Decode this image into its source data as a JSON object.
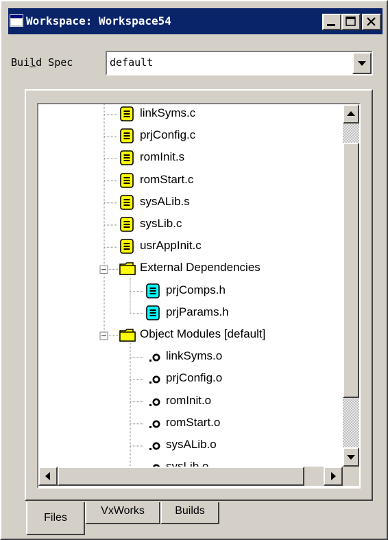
{
  "window": {
    "title": "Workspace: Workspace54",
    "buttons": {
      "minimize": "minimize",
      "maximize": "maximize",
      "close": "close"
    }
  },
  "build_spec": {
    "label_before": "Bui",
    "label_underlined": "l",
    "label_after": "d Spec",
    "value": "default"
  },
  "tree": {
    "items": [
      {
        "label": "linkSyms.c",
        "icon": "source-file-icon"
      },
      {
        "label": "prjConfig.c",
        "icon": "source-file-icon"
      },
      {
        "label": "romInit.s",
        "icon": "source-file-icon"
      },
      {
        "label": "romStart.c",
        "icon": "source-file-icon"
      },
      {
        "label": "sysALib.s",
        "icon": "source-file-icon"
      },
      {
        "label": "sysLib.c",
        "icon": "source-file-icon"
      },
      {
        "label": "usrAppInit.c",
        "icon": "source-file-icon"
      },
      {
        "label": "External Dependencies",
        "icon": "folder-icon"
      },
      {
        "label": "prjComps.h",
        "icon": "header-file-icon"
      },
      {
        "label": "prjParams.h",
        "icon": "header-file-icon"
      },
      {
        "label": "Object Modules [default]",
        "icon": "folder-icon"
      },
      {
        "label": "linkSyms.o",
        "icon": "object-file-icon"
      },
      {
        "label": "prjConfig.o",
        "icon": "object-file-icon"
      },
      {
        "label": "romInit.o",
        "icon": "object-file-icon"
      },
      {
        "label": "romStart.o",
        "icon": "object-file-icon"
      },
      {
        "label": "sysALib.o",
        "icon": "object-file-icon"
      },
      {
        "label": "sysLib.o",
        "icon": "object-file-icon"
      }
    ]
  },
  "tabs": [
    {
      "label": "Files",
      "active": true
    },
    {
      "label": "VxWorks",
      "active": false
    },
    {
      "label": "Builds",
      "active": false
    }
  ],
  "colors": {
    "titlebar": "#0a246a",
    "source_icon": "#ffff00",
    "header_icon": "#00ffff",
    "folder": "#ffff00"
  }
}
